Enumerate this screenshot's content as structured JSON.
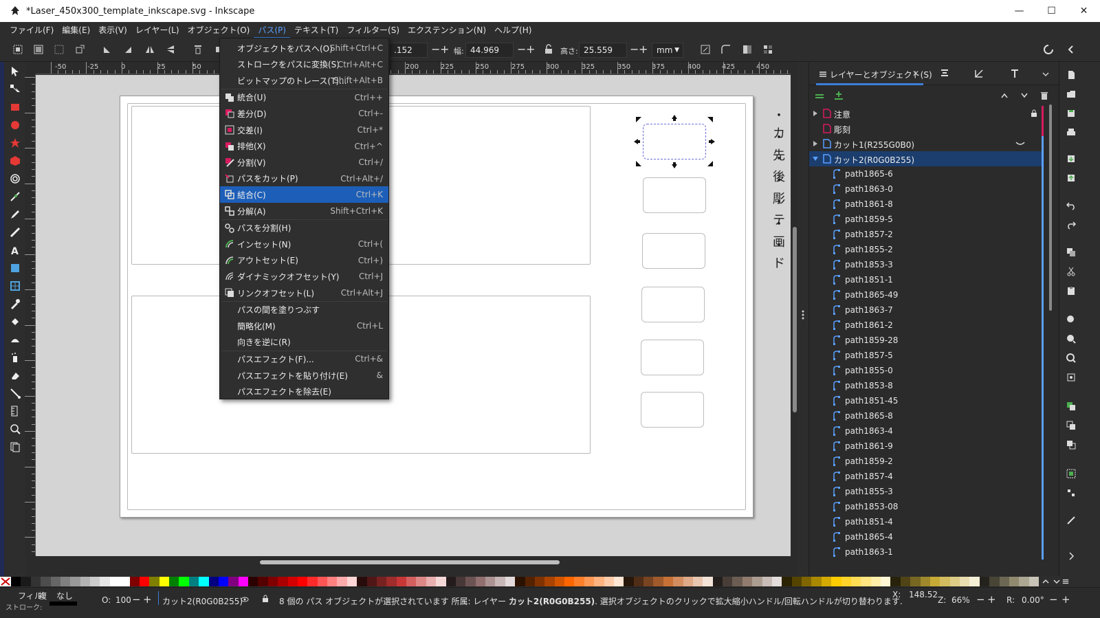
{
  "window": {
    "title": "*Laser_450x300_template_inkscape.svg - Inkscape",
    "minimize": "—",
    "maximize": "☐",
    "close": "✕"
  },
  "menubar": [
    "ファイル(F)",
    "編集(E)",
    "表示(V)",
    "レイヤー(L)",
    "オブジェクト(O)",
    "パス(P)",
    "テキスト(T)",
    "フィルター(S)",
    "エクステンション(N)",
    "ヘルプ(H)"
  ],
  "active_menu": "パス(P)",
  "toolbar": {
    "x_value": ".152",
    "w_label": "幅:",
    "w_value": "44.969",
    "h_label": "高さ:",
    "h_value": "25.559",
    "unit": "mm"
  },
  "ruler_top": [
    "-50",
    "-25",
    "0",
    "25",
    "50",
    "200",
    "225",
    "250",
    "275",
    "300",
    "325",
    "350",
    "375",
    "400",
    "425",
    "450"
  ],
  "path_menu": [
    {
      "label": "オブジェクトをパスへ(O)",
      "shortcut": "Shift+Ctrl+C",
      "icon": ""
    },
    {
      "label": "ストロークをパスに変換(S)",
      "shortcut": "Ctrl+Alt+C",
      "icon": ""
    },
    {
      "label": "ビットマップのトレース(T)...",
      "shortcut": "Shift+Alt+B",
      "icon": ""
    },
    {
      "label": "統合(U)",
      "shortcut": "Ctrl++",
      "icon": "union"
    },
    {
      "label": "差分(D)",
      "shortcut": "Ctrl+-",
      "icon": "difference"
    },
    {
      "label": "交差(I)",
      "shortcut": "Ctrl+*",
      "icon": "intersection"
    },
    {
      "label": "排他(X)",
      "shortcut": "Ctrl+^",
      "icon": "exclusion"
    },
    {
      "label": "分割(V)",
      "shortcut": "Ctrl+/",
      "icon": "division"
    },
    {
      "label": "パスをカット(P)",
      "shortcut": "Ctrl+Alt+/",
      "icon": "cut-path"
    },
    {
      "label": "結合(C)",
      "shortcut": "Ctrl+K",
      "icon": "combine",
      "highlighted": true
    },
    {
      "label": "分解(A)",
      "shortcut": "Shift+Ctrl+K",
      "icon": "break-apart"
    },
    {
      "label": "パスを分割(H)",
      "shortcut": "",
      "icon": "split-path"
    },
    {
      "label": "インセット(N)",
      "shortcut": "Ctrl+(",
      "icon": "inset"
    },
    {
      "label": "アウトセット(E)",
      "shortcut": "Ctrl+)",
      "icon": "outset"
    },
    {
      "label": "ダイナミックオフセット(Y)",
      "shortcut": "Ctrl+J",
      "icon": "dynamic-offset"
    },
    {
      "label": "リンクオフセット(L)",
      "shortcut": "Ctrl+Alt+J",
      "icon": "linked-offset"
    },
    {
      "label": "パスの間を塗りつぶす",
      "shortcut": "",
      "icon": ""
    },
    {
      "label": "簡略化(M)",
      "shortcut": "Ctrl+L",
      "icon": ""
    },
    {
      "label": "向きを逆に(R)",
      "shortcut": "",
      "icon": ""
    },
    {
      "label": "パスエフェクト(F)...",
      "shortcut": "Ctrl+&",
      "icon": ""
    },
    {
      "label": "パスエフェクトを貼り付け(E)",
      "shortcut": "&",
      "icon": ""
    },
    {
      "label": "パスエフェクトを除去(E)",
      "shortcut": "",
      "icon": ""
    }
  ],
  "canvas_bullets": [
    "・カ",
    "・先",
    "・後",
    "・彫",
    "・テ",
    "・画",
    "・ド"
  ],
  "panel": {
    "tab_label": "レイヤーとオブジェクト(S)",
    "layers": [
      {
        "name": "注意",
        "expandable": true,
        "color": "#d81b60",
        "locked": true
      },
      {
        "name": "彫刻",
        "expandable": false,
        "color": "#d81b60"
      },
      {
        "name": "カット1(R255G0B0)",
        "expandable": true,
        "color": "#5aa0ff",
        "hidden_icon": true
      },
      {
        "name": "カット2(R0G0B255)",
        "expandable": true,
        "expanded": true,
        "color": "#5aa0ff",
        "selected": true
      }
    ],
    "paths": [
      "path1865-6",
      "path1863-0",
      "path1861-8",
      "path1859-5",
      "path1857-2",
      "path1855-2",
      "path1853-3",
      "path1851-1",
      "path1865-49",
      "path1863-7",
      "path1861-2",
      "path1859-28",
      "path1857-5",
      "path1855-0",
      "path1853-8",
      "path1851-45",
      "path1865-8",
      "path1863-4",
      "path1861-9",
      "path1859-2",
      "path1857-4",
      "path1855-3",
      "path1853-08",
      "path1851-4",
      "path1865-4",
      "path1863-1"
    ]
  },
  "palette": [
    "#000000",
    "#1a1a1a",
    "#333333",
    "#4d4d4d",
    "#666666",
    "#808080",
    "#999999",
    "#b3b3b3",
    "#cccccc",
    "#e6e6e6",
    "#ffffff",
    "#ffffff",
    "#800000",
    "#ff0000",
    "#808000",
    "#ffff00",
    "#008000",
    "#00ff00",
    "#008080",
    "#00ffff",
    "#000080",
    "#0000ff",
    "#800080",
    "#ff00ff",
    "#2b0000",
    "#550000",
    "#800000",
    "#aa0000",
    "#d40000",
    "#ff0000",
    "#ff2a2a",
    "#ff5555",
    "#ff8080",
    "#ffaaaa",
    "#ffd5d5",
    "#280b0b",
    "#501616",
    "#782121",
    "#a02c2c",
    "#c83737",
    "#d35f5f",
    "#de8787",
    "#e9afaf",
    "#f4d7d7",
    "#241c1c",
    "#483737",
    "#6c5353",
    "#916f6f",
    "#ac9393",
    "#c8b7b7",
    "#e3dbdb",
    "#2b1100",
    "#552200",
    "#803300",
    "#aa4400",
    "#d45500",
    "#ff6600",
    "#ff7f2a",
    "#ff9955",
    "#ffb380",
    "#ffccaa",
    "#ffe6d5",
    "#28170b",
    "#502d16",
    "#784421",
    "#a05a2c",
    "#c87137",
    "#d38d5f",
    "#deaa87",
    "#e9c6af",
    "#f4e3d7",
    "#241f1c",
    "#483e37",
    "#6c5d53",
    "#917c6f",
    "#ac9d93",
    "#c8beb7",
    "#e3dedb",
    "#2b2200",
    "#554400",
    "#806600",
    "#aa8800",
    "#d4aa00",
    "#ffcc00",
    "#ffd42a",
    "#ffdd55",
    "#ffe680",
    "#ffeeaa",
    "#fff6d5",
    "#28220b",
    "#504416",
    "#786721",
    "#a0892c",
    "#c8ab37",
    "#d3bc5f",
    "#decd87",
    "#e9ddaf",
    "#f4eed7",
    "#24221c",
    "#484537",
    "#6c6753",
    "#918a6f",
    "#aca793",
    "#c8c4b7"
  ],
  "status": {
    "fill_label": "フィル:",
    "fill_value": "複",
    "stroke_label": "ストローク:",
    "stroke_value": "なし",
    "opacity_label": "O:",
    "opacity_value": "100",
    "layer_name": "カット2(R0G0B255)",
    "message_prefix": "8 個の パス オブジェクトが選択されています 所属: レイヤー ",
    "message_layer": "カット2(R0G0B255)",
    "message_suffix": ". 選択オブジェクトのクリックで拡大縮小ハンドル/回転ハンドルが切り替わります.",
    "x_label": "X:",
    "x_value": "148.52",
    "zoom_label": "Z:",
    "zoom_value": "66%",
    "rotate_label": "R:",
    "rotate_value": "0.00°"
  }
}
